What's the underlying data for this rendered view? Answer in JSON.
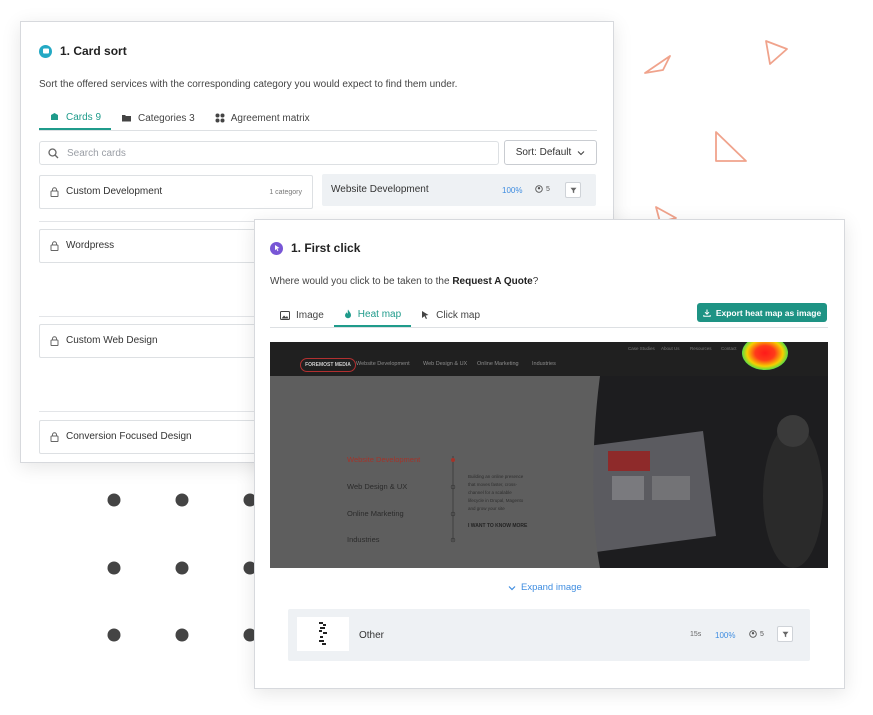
{
  "card_sort": {
    "title": "1. Card sort",
    "description": "Sort the offered services with the corresponding category you would expect to find them under.",
    "tabs": [
      {
        "label": "Cards 9",
        "active": true
      },
      {
        "label": "Categories 3",
        "active": false
      },
      {
        "label": "Agreement matrix",
        "active": false
      }
    ],
    "search_placeholder": "Search cards",
    "sort_label": "Sort: Default",
    "cards": [
      {
        "label": "Custom Development",
        "meta": "1 category"
      },
      {
        "label": "Wordpress"
      },
      {
        "label": "Custom Web Design"
      },
      {
        "label": "Conversion Focused Design"
      }
    ],
    "result": {
      "label": "Website Development",
      "percent": "100%",
      "count": "5"
    }
  },
  "first_click": {
    "title": "1. First click",
    "question_prefix": "Where would you click to be taken to the ",
    "question_bold": "Request A Quote",
    "question_suffix": "?",
    "tabs": [
      {
        "label": "Image",
        "active": false
      },
      {
        "label": "Heat map",
        "active": true
      },
      {
        "label": "Click map",
        "active": false
      }
    ],
    "export_label": "Export heat map as image",
    "heatmap": {
      "logo": "FOREMOST MEDIA",
      "nav": [
        "Website Development",
        "Web Design & UX",
        "Online Marketing",
        "Industries"
      ],
      "top_links": [
        "Case Studies",
        "About Us",
        "Resources",
        "Contact"
      ],
      "menu_items": [
        "Website Development",
        "Web Design & UX",
        "Online Marketing",
        "Industries"
      ],
      "body_lines": [
        "Building an online presence",
        "that moves faster, cross-",
        "channel for a scalable",
        "lifecycle in Drupal, Magento",
        "and grow your site"
      ],
      "cta": "I WANT TO KNOW MORE"
    },
    "expand_label": "Expand image",
    "row": {
      "label": "Other",
      "time": "15s",
      "percent": "100%",
      "count": "5"
    }
  },
  "colors": {
    "accent": "#1f9b8b",
    "link": "#3f8de0",
    "decor": "#f0a38c"
  }
}
